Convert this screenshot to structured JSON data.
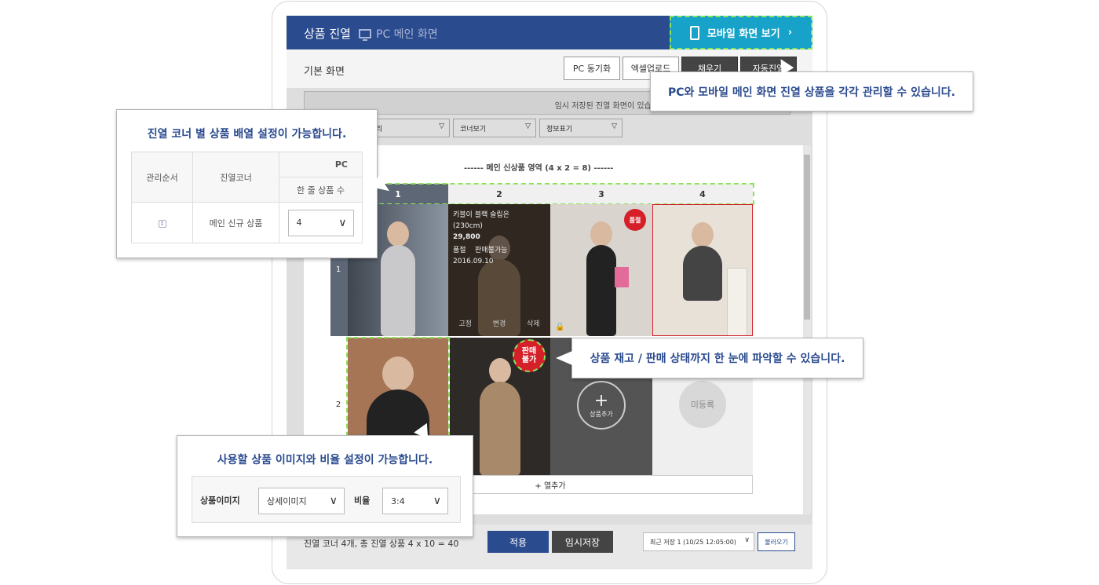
{
  "header": {
    "title": "상품 진열",
    "subtitle": "PC 메인 화면",
    "mobile_button": "모바일 화면 보기",
    "mobile_chevron": "›"
  },
  "toolbar": {
    "page_title": "기본 화면",
    "buttons": [
      "PC 동기화",
      "엑셀업로드",
      "채우기",
      "자동진열"
    ]
  },
  "notice": {
    "text": "임시 저장된 진열 화면이 있습니다. 임시 저장 화면을 불러오시려면 클"
  },
  "filters": [
    {
      "label": "일괄처리"
    },
    {
      "label": "코너보기"
    },
    {
      "label": "정보표기"
    }
  ],
  "grid": {
    "area_title": "------ 메인 신상품 영역 (4 x 2 = 8) ------",
    "columns": [
      "1",
      "2",
      "3",
      "4"
    ],
    "rows": [
      "1",
      "2"
    ],
    "product_info": {
      "name": "키블이 블랙 슬립온",
      "size": "(230cm)",
      "price": "29,800",
      "status": "품절",
      "sale": "판매불가능",
      "date": "2016.09.10",
      "actions": [
        "고정",
        "변경",
        "삭제"
      ]
    },
    "soldout_badge": "품절",
    "notsale_badge": "판매불가",
    "add_product": "상품추가",
    "unregistered": "미등록",
    "add_column": "+ 열추가"
  },
  "bottom": {
    "summary": "진열 코너 4개, 총 진열 상품 4 x 10 = 40",
    "apply": "적용",
    "temp_save": "임시저장",
    "recent": "최근 저장 1 (10/25 12:05:00)",
    "load": "불러오기"
  },
  "callouts": {
    "mobile": "PC와 모바일 메인 화면 진열 상품을 각각 관리할 수 있습니다.",
    "corner": {
      "text": "진열 코너 별 상품 배열 설정이 가능합니다.",
      "col_order": "관리순서",
      "col_corner": "진열코너",
      "col_pc": "PC",
      "col_per_row": "한 줄 상품 수",
      "row_corner": "메인 신규 상품",
      "row_value": "4"
    },
    "stock": "상품 재고 / 판매 상태까지 한 눈에 파악할 수 있습니다.",
    "image": {
      "text": "사용할 상품 이미지와 비율 설정이 가능합니다.",
      "image_label": "상품이미지",
      "image_value": "상세이미지",
      "ratio_label": "비율",
      "ratio_value": "3:4"
    }
  },
  "colors": {
    "header": "#2b4b8f",
    "mobile_button": "#16a2c9",
    "highlight_dash": "#8be25a",
    "badge_red": "#d5202a"
  }
}
